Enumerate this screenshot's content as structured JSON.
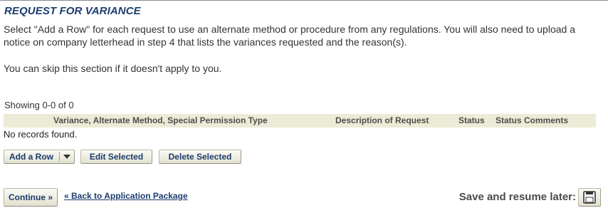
{
  "section": {
    "title": "REQUEST FOR VARIANCE",
    "intro": "Select \"Add a Row\" for each request to use an alternate method or procedure from any regulations. You will also need to upload a notice on company letterhead in step 4 that lists the variances requested and the reason(s).",
    "skip_note": "You can skip this section if it doesn't apply to you."
  },
  "table": {
    "showing": "Showing 0-0 of 0",
    "columns": [
      "Variance, Alternate Method, Special Permission Type",
      "Description of Request",
      "Status",
      "Status Comments"
    ],
    "empty_message": "No records found."
  },
  "toolbar": {
    "add_row": "Add a Row",
    "edit_selected": "Edit Selected",
    "delete_selected": "Delete Selected"
  },
  "footer": {
    "continue": "Continue »",
    "back_link": "« Back to Application Package",
    "save_resume": "Save and resume later:"
  },
  "icons": {
    "dropdown": "chevron-down-icon",
    "save": "floppy-disk-icon"
  }
}
